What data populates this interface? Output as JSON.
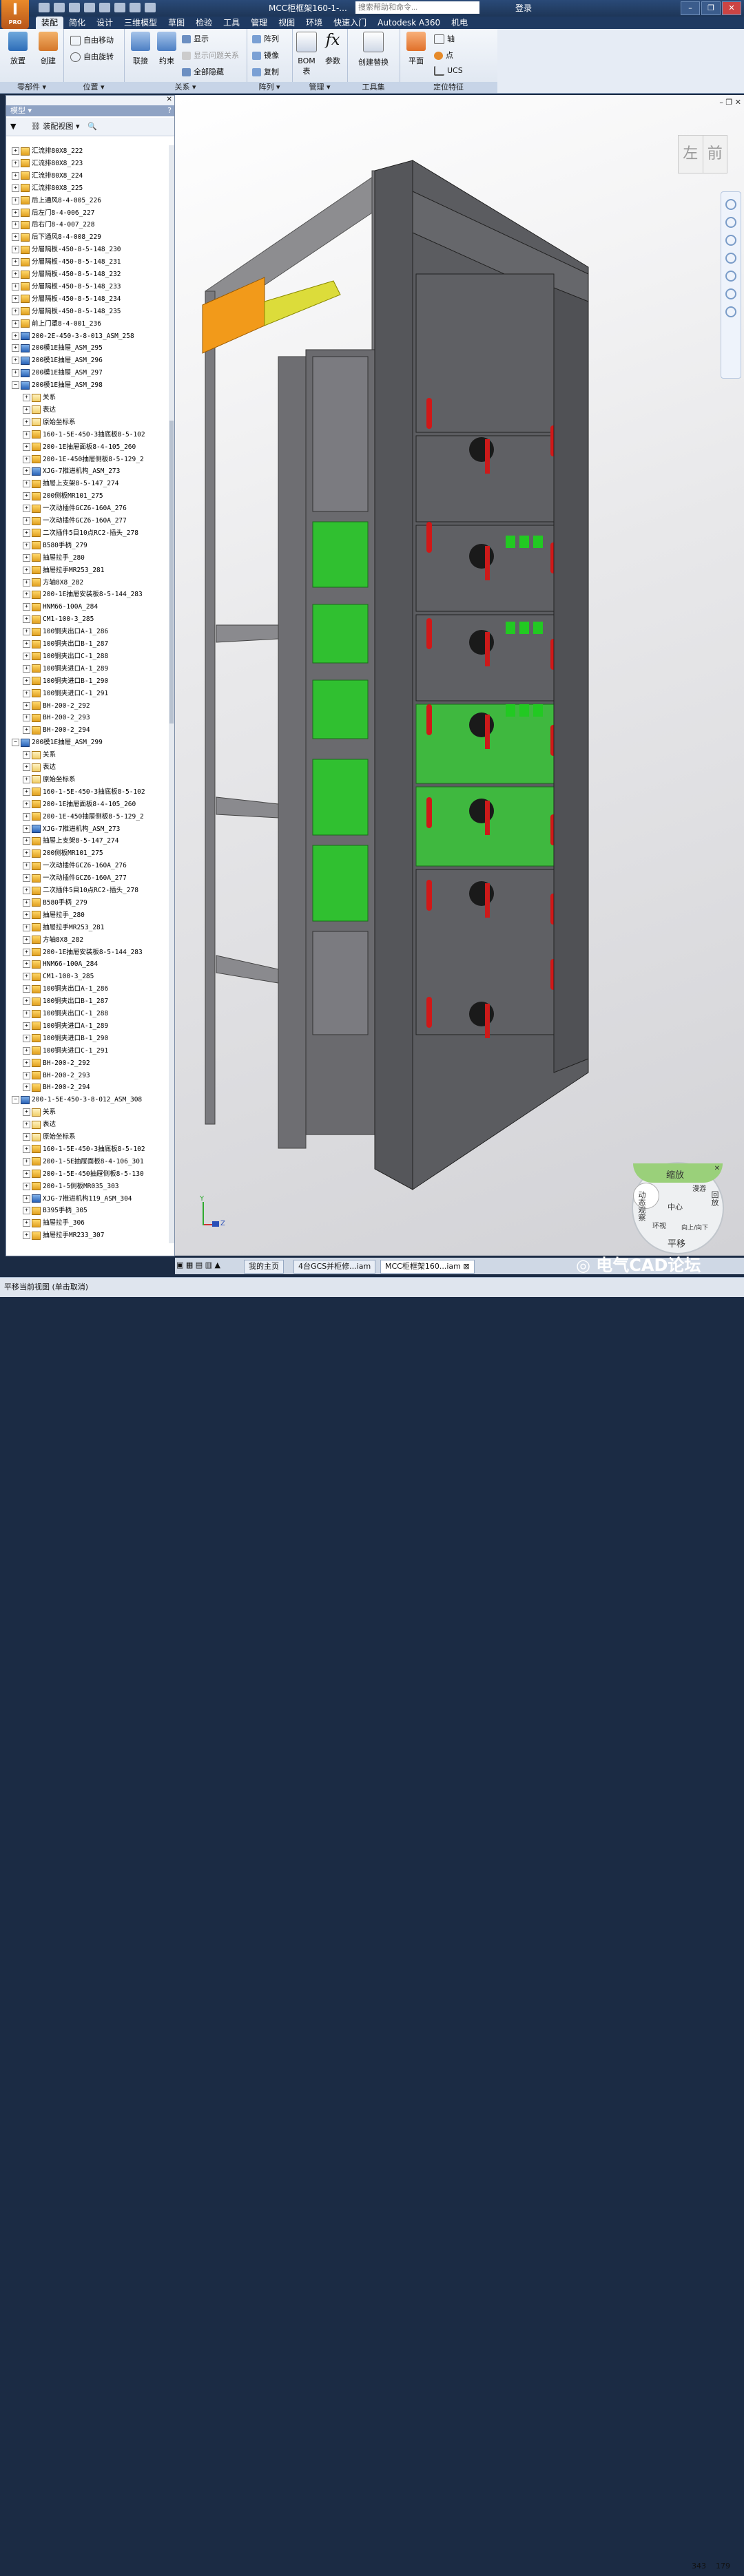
{
  "app": {
    "badge": "I",
    "badge_sub": "PRO",
    "doc_title": "MCC柜框架160-1-...",
    "search_placeholder": "搜索帮助和命令...",
    "login": "登录"
  },
  "tabs": [
    "装配",
    "简化",
    "设计",
    "三维模型",
    "草图",
    "检验",
    "工具",
    "管理",
    "视图",
    "环境",
    "快速入门",
    "Autodesk A360",
    "机电"
  ],
  "ribbon": {
    "place": "放置",
    "create": "创建",
    "panel_components": "零部件 ▾",
    "free_move": "自由移动",
    "free_rotate": "自由旋转",
    "panel_position": "位置 ▾",
    "joint": "联接",
    "constrain": "约束",
    "show": "显示",
    "show_problem": "显示问题关系",
    "hide_all": "全部隐藏",
    "panel_relations": "关系 ▾",
    "pattern": "阵列",
    "mirror": "镜像",
    "copy": "复制",
    "panel_pattern": "阵列 ▾",
    "bom": "BOM\n表",
    "params": "参数",
    "panel_manage": "管理 ▾",
    "substitute": "创建替换",
    "panel_productivity": "工具集",
    "plane": "平面",
    "axis": "轴",
    "point": "点",
    "ucs": "UCS",
    "panel_work": "定位特征"
  },
  "browser": {
    "title": "模型 ▾",
    "view": "装配视图"
  },
  "tree": [
    "汇流排80X8_222",
    "汇流排80X8_223",
    "汇流排80X8_224",
    "汇流排80X8_225",
    "后上通风8-4-005_226",
    "后左门8-4-006_227",
    "后右门8-4-007_228",
    "后下通风8-4-008_229",
    "分層隔板-450-8-5-148_230",
    "分層隔板-450-8-5-148_231",
    "分層隔板-450-8-5-148_232",
    "分層隔板-450-8-5-148_233",
    "分層隔板-450-8-5-148_234",
    "分層隔板-450-8-5-148_235",
    "前上门罩8-4-001_236",
    "200-2E-450-3-8-013_ASM_258",
    "200模1E抽屉_ASM_295",
    "200模1E抽屉_ASM_296",
    "200模1E抽屉_ASM_297",
    "200模1E抽屉_ASM_298",
    "关系",
    "表达",
    "原始坐标系",
    "160-1-5E-450-3抽底板8-5-102",
    "200-1E抽屉面板8-4-105_260",
    "200-1E-450抽屉侧板8-5-129_2",
    "XJG-7推进机构_ASM_273",
    "抽屉上支架8-5-147_274",
    "200侧板MR101_275",
    "一次动插件GCZ6-160A_276",
    "一次动插件GCZ6-160A_277",
    "二次插件5目10点RC2-插头_278",
    "B580手柄_279",
    "抽屉拉手_280",
    "抽屉拉手MR253_281",
    "方轴8X8_282",
    "200-1E抽屉安装板8-5-144_283",
    "HNM66-100A_284",
    "CM1-100-3_285",
    "100铜夹出口A-1_286",
    "100铜夹出口B-1_287",
    "100铜夹出口C-1_288",
    "100铜夹进口A-1_289",
    "100铜夹进口B-1_290",
    "100铜夹进口C-1_291",
    "BH-200-2_292",
    "BH-200-2_293",
    "BH-200-2_294",
    "200模1E抽屉_ASM_299",
    "关系",
    "表达",
    "原始坐标系",
    "160-1-5E-450-3抽底板8-5-102",
    "200-1E抽屉面板8-4-105_260",
    "200-1E-450抽屉侧板8-5-129_2",
    "XJG-7推进机构_ASM_273",
    "抽屉上支架8-5-147_274",
    "200侧板MR101_275",
    "一次动插件GCZ6-160A_276",
    "一次动插件GCZ6-160A_277",
    "二次插件5目10点RC2-插头_278",
    "B580手柄_279",
    "抽屉拉手_280",
    "抽屉拉手MR253_281",
    "方轴8X8_282",
    "200-1E抽屉安装板8-5-144_283",
    "HNM66-100A_284",
    "CM1-100-3_285",
    "100铜夹出口A-1_286",
    "100铜夹出口B-1_287",
    "100铜夹出口C-1_288",
    "100铜夹进口A-1_289",
    "100铜夹进口B-1_290",
    "100铜夹进口C-1_291",
    "BH-200-2_292",
    "BH-200-2_293",
    "BH-200-2_294",
    "200-1-5E-450-3-8-012_ASM_308",
    "关系",
    "表达",
    "原始坐标系",
    "160-1-5E-450-3抽底板8-5-102",
    "200-1-5E抽屉面板8-4-106_301",
    "200-1-5E-450抽屉侧板8-5-130",
    "200-1-5侧板MR035_303",
    "XJG-7推进机构119_ASM_304",
    "B395手柄_305",
    "抽屉拉手_306",
    "抽屉拉手MR233_307"
  ],
  "viewcube": {
    "left": "左",
    "front": "前"
  },
  "wheel": {
    "zoom": "缩放",
    "center": "中心",
    "orbit": "动态观察",
    "rewind": "回放",
    "walk": "漫游",
    "lookup": "向上/向下",
    "look": "环视",
    "pan": "平移"
  },
  "axis": {
    "y": "Y",
    "z": "Z"
  },
  "doc_tabs": [
    "我的主页",
    "4台GCS并柜修...iam",
    "MCC柜框架160...iam"
  ],
  "status": {
    "text": "平移当前视图 (单击取消)",
    "x": "343",
    "y": "179"
  },
  "watermark": "电气CAD论坛"
}
